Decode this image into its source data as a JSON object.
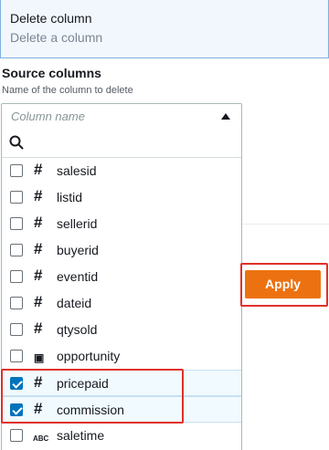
{
  "header": {
    "title": "Delete column",
    "subtitle": "Delete a column"
  },
  "source_columns": {
    "label": "Source columns",
    "description": "Name of the column to delete",
    "placeholder": "Column name"
  },
  "columns": [
    {
      "name": "salesid",
      "type_icon": "number-icon",
      "type_glyph": "#",
      "checked": false
    },
    {
      "name": "listid",
      "type_icon": "number-icon",
      "type_glyph": "#",
      "checked": false
    },
    {
      "name": "sellerid",
      "type_icon": "number-icon",
      "type_glyph": "#",
      "checked": false
    },
    {
      "name": "buyerid",
      "type_icon": "number-icon",
      "type_glyph": "#",
      "checked": false
    },
    {
      "name": "eventid",
      "type_icon": "number-icon",
      "type_glyph": "#",
      "checked": false
    },
    {
      "name": "dateid",
      "type_icon": "number-icon",
      "type_glyph": "#",
      "checked": false
    },
    {
      "name": "qtysold",
      "type_icon": "number-icon",
      "type_glyph": "#",
      "checked": false
    },
    {
      "name": "opportunity",
      "type_icon": "mixed-type-icon",
      "type_glyph": "▣",
      "checked": false
    },
    {
      "name": "pricepaid",
      "type_icon": "number-icon",
      "type_glyph": "#",
      "checked": true
    },
    {
      "name": "commission",
      "type_icon": "number-icon",
      "type_glyph": "#",
      "checked": true
    },
    {
      "name": "saletime",
      "type_icon": "string-icon",
      "type_glyph": "ABC",
      "checked": false
    }
  ],
  "apply_button": {
    "label": "Apply"
  },
  "colors": {
    "accent_orange": "#ec7211",
    "highlight_red": "#e0302a",
    "checkbox_blue": "#0073bb"
  }
}
